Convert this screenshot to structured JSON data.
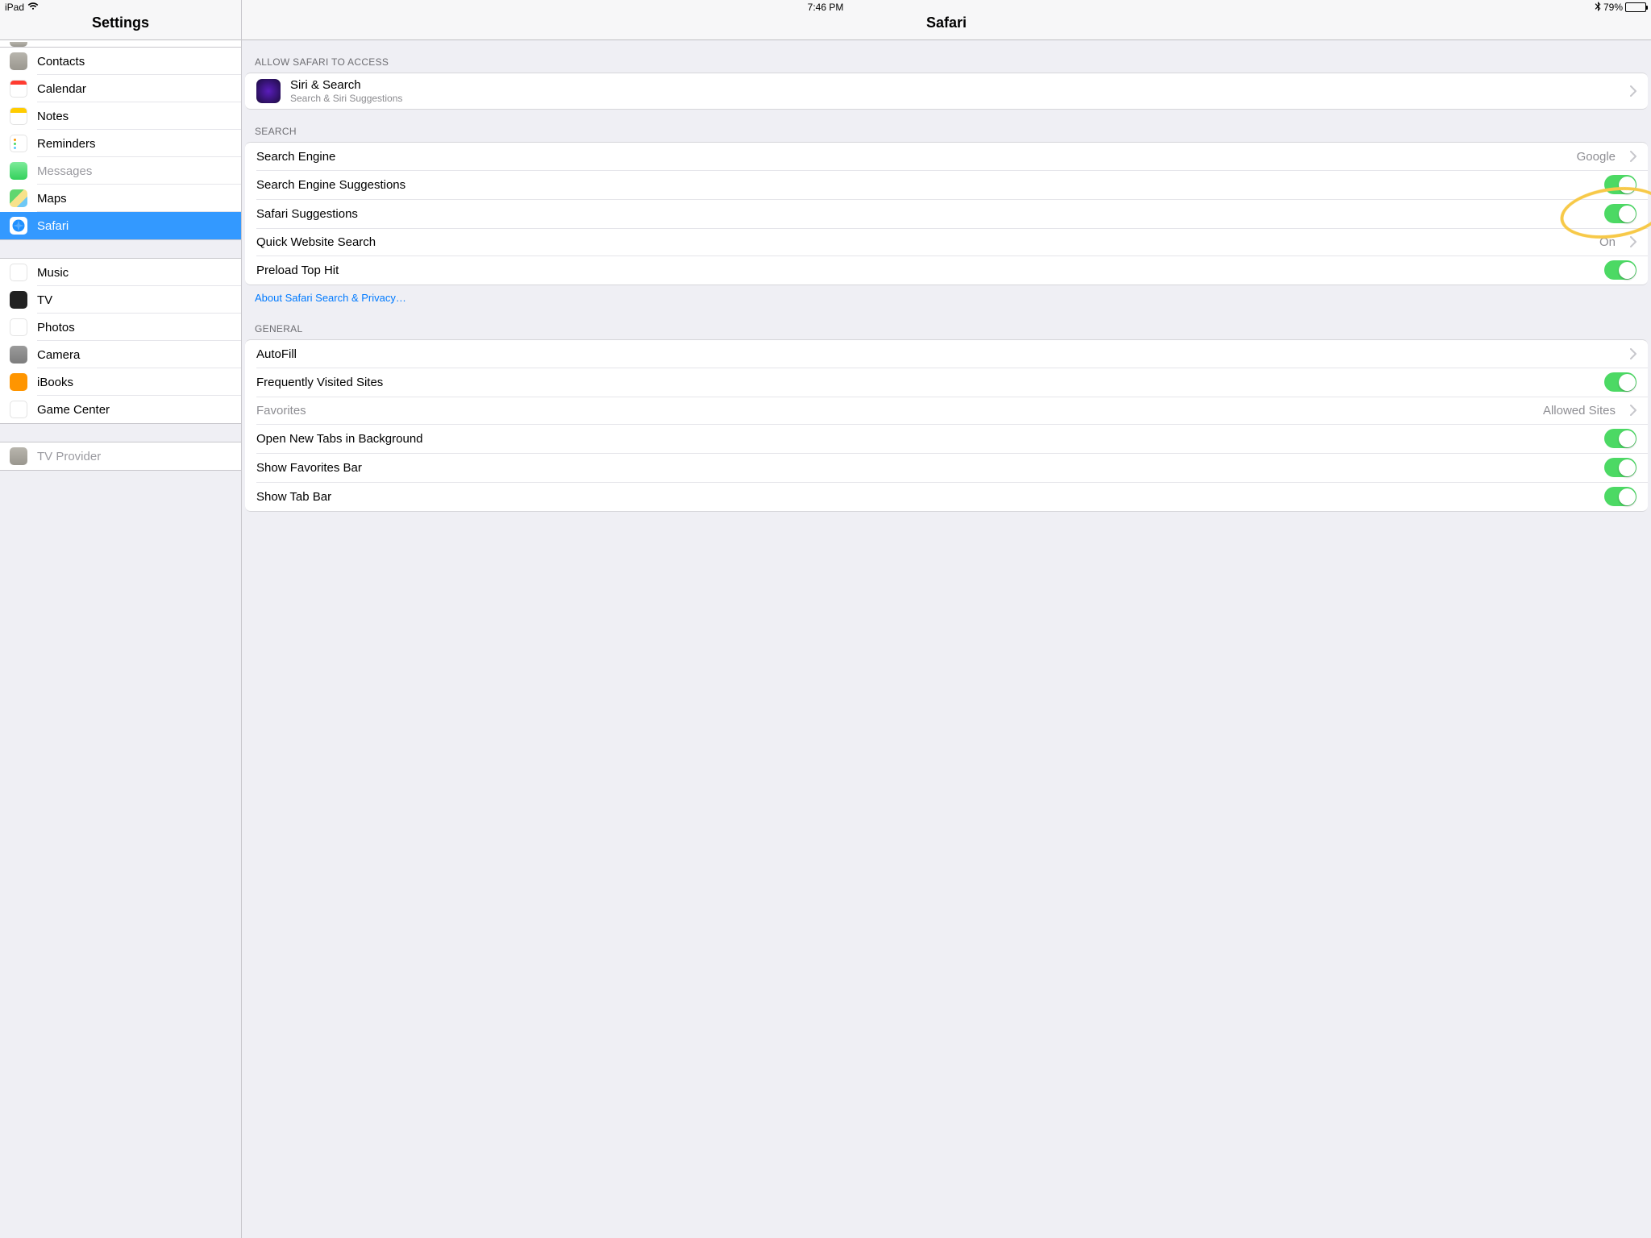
{
  "status": {
    "device": "iPad",
    "time": "7:46 PM",
    "battery_pct": "79%"
  },
  "sidebar": {
    "title": "Settings",
    "groups": [
      {
        "id": "g0",
        "partial_top": true,
        "items": [
          {
            "id": "contacts",
            "label": "Contacts",
            "icon": "ic-contacts"
          },
          {
            "id": "calendar",
            "label": "Calendar",
            "icon": "ic-calendar"
          },
          {
            "id": "notes",
            "label": "Notes",
            "icon": "ic-notes"
          },
          {
            "id": "reminders",
            "label": "Reminders",
            "icon": "ic-reminders"
          },
          {
            "id": "messages",
            "label": "Messages",
            "icon": "ic-messages",
            "disabled": true
          },
          {
            "id": "maps",
            "label": "Maps",
            "icon": "ic-maps"
          },
          {
            "id": "safari",
            "label": "Safari",
            "icon": "ic-safari",
            "selected": true
          }
        ]
      },
      {
        "id": "g1",
        "items": [
          {
            "id": "music",
            "label": "Music",
            "icon": "ic-music"
          },
          {
            "id": "tv",
            "label": "TV",
            "icon": "ic-tv"
          },
          {
            "id": "photos",
            "label": "Photos",
            "icon": "ic-photos"
          },
          {
            "id": "camera",
            "label": "Camera",
            "icon": "ic-camera"
          },
          {
            "id": "ibooks",
            "label": "iBooks",
            "icon": "ic-ibooks"
          },
          {
            "id": "gamecenter",
            "label": "Game Center",
            "icon": "ic-gc"
          }
        ]
      },
      {
        "id": "g2",
        "items": [
          {
            "id": "tvprovider",
            "label": "TV Provider",
            "icon": "ic-tvp",
            "disabled": true
          }
        ]
      }
    ]
  },
  "detail": {
    "title": "Safari",
    "sections": [
      {
        "header": "ALLOW SAFARI TO ACCESS",
        "rows": [
          {
            "id": "siri",
            "type": "nav_sub",
            "label": "Siri & Search",
            "sub": "Search & Siri Suggestions",
            "icon": "ic-siri"
          }
        ]
      },
      {
        "header": "SEARCH",
        "footer": "About Safari Search & Privacy…",
        "rows": [
          {
            "id": "engine",
            "type": "nav",
            "label": "Search Engine",
            "value": "Google"
          },
          {
            "id": "eng_sugg",
            "type": "toggle",
            "label": "Search Engine Suggestions",
            "on": true
          },
          {
            "id": "saf_sugg",
            "type": "toggle",
            "label": "Safari Suggestions",
            "on": true,
            "highlight": true
          },
          {
            "id": "quick",
            "type": "nav",
            "label": "Quick Website Search",
            "value": "On"
          },
          {
            "id": "preload",
            "type": "toggle",
            "label": "Preload Top Hit",
            "on": true
          }
        ]
      },
      {
        "header": "GENERAL",
        "rows": [
          {
            "id": "autofill",
            "type": "nav",
            "label": "AutoFill"
          },
          {
            "id": "freq",
            "type": "toggle",
            "label": "Frequently Visited Sites",
            "on": true
          },
          {
            "id": "fav",
            "type": "nav",
            "label": "Favorites",
            "value": "Allowed Sites",
            "disabled": true
          },
          {
            "id": "newtab",
            "type": "toggle",
            "label": "Open New Tabs in Background",
            "on": true
          },
          {
            "id": "favbar",
            "type": "toggle",
            "label": "Show Favorites Bar",
            "on": true
          },
          {
            "id": "tabbar",
            "type": "toggle",
            "label": "Show Tab Bar",
            "on": true
          }
        ]
      }
    ]
  }
}
